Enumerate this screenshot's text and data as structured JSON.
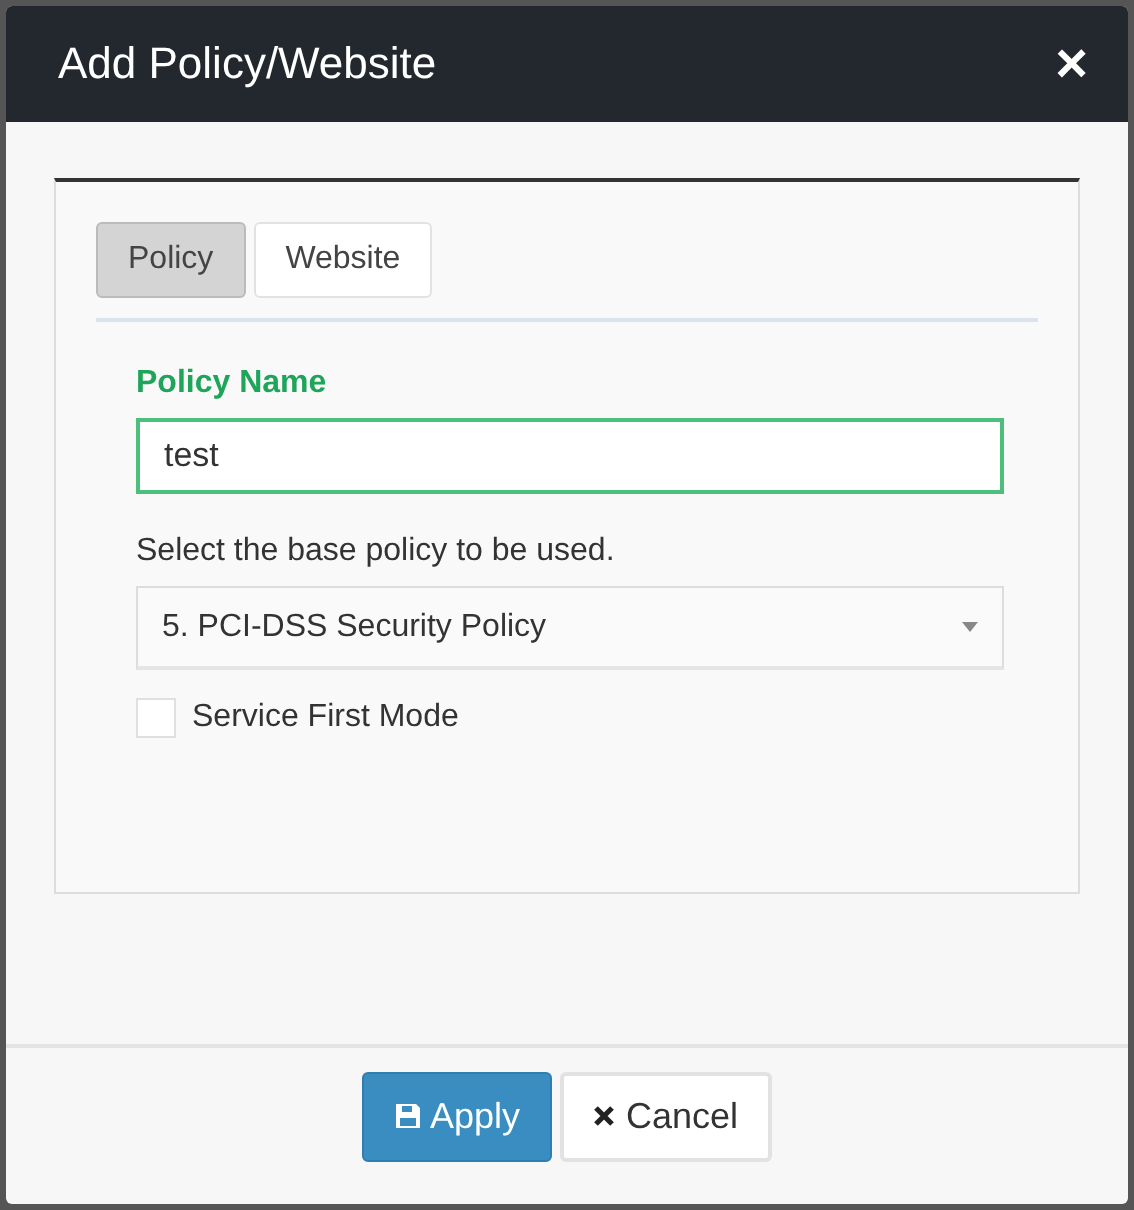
{
  "dialog": {
    "title": "Add Policy/Website",
    "close": "×"
  },
  "tabs": [
    {
      "label": "Policy",
      "selected": true
    },
    {
      "label": "Website",
      "selected": false
    }
  ],
  "policy_name": {
    "label": "Policy Name",
    "value": "test"
  },
  "base_policy": {
    "label": "Select the base policy to be used.",
    "value": "5. PCI-DSS Security Policy"
  },
  "service_first_mode": {
    "label": "Service First Mode",
    "checked": false
  },
  "buttons": [
    {
      "kind": "apply",
      "label": "Apply"
    },
    {
      "kind": "cancel",
      "label": "Cancel"
    }
  ]
}
